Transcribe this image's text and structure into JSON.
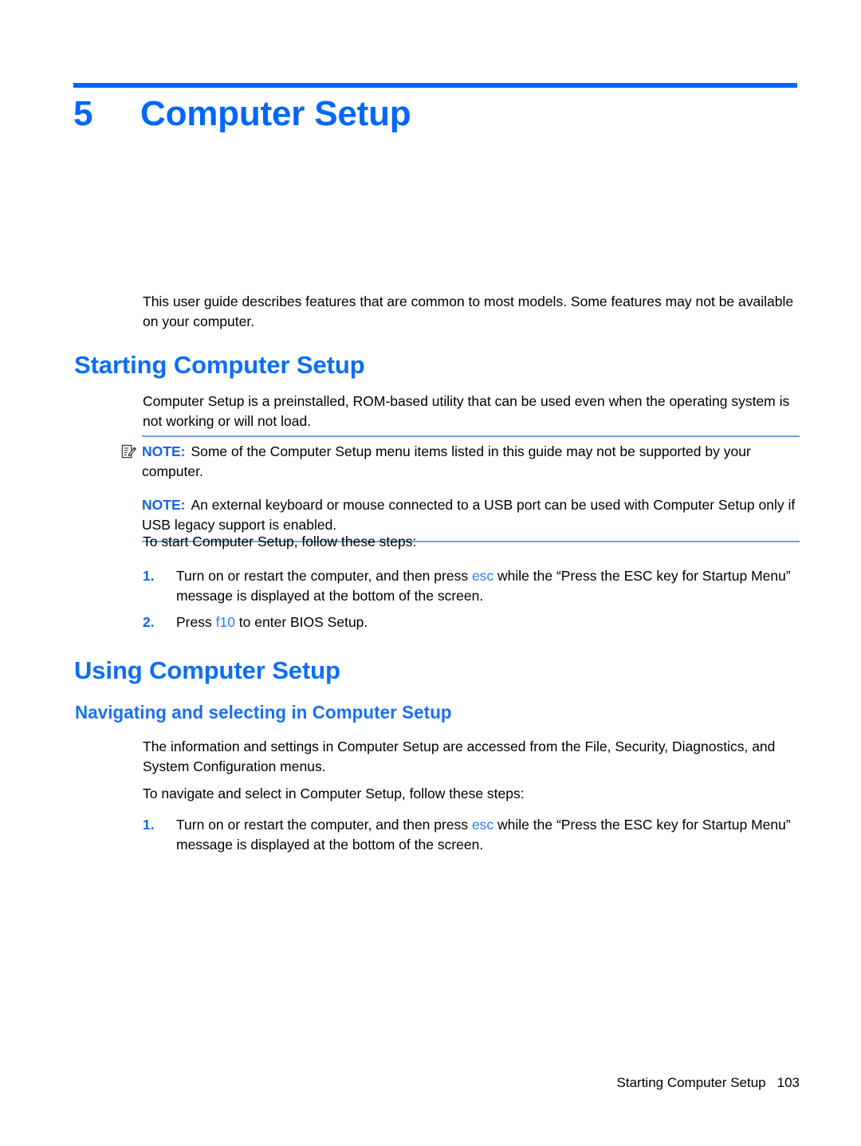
{
  "chapter": {
    "number": "5",
    "title": "Computer Setup"
  },
  "intro": {
    "paragraph": "This user guide describes features that are common to most models. Some features may not be available on your computer."
  },
  "sections": [
    {
      "heading": "Starting Computer Setup",
      "paragraph": "Computer Setup is a preinstalled, ROM-based utility that can be used even when the operating system is not working or will not load.",
      "notes": [
        {
          "icon": "note-pencil-icon",
          "label": "NOTE:",
          "text": "Some of the Computer Setup menu items listed in this guide may not be supported by your computer."
        },
        {
          "icon": null,
          "label": "NOTE:",
          "text": "An external keyboard or mouse connected to a USB port can be used with Computer Setup only if USB legacy support is enabled."
        }
      ],
      "lead_in": "To start Computer Setup, follow these steps:",
      "steps": [
        {
          "number": "1.",
          "parts": [
            {
              "type": "text",
              "value": "Turn on or restart the computer, and then press "
            },
            {
              "type": "key",
              "value": "esc"
            },
            {
              "type": "text",
              "value": " while the “Press the ESC key for Startup Menu” message is displayed at the bottom of the screen."
            }
          ]
        },
        {
          "number": "2.",
          "parts": [
            {
              "type": "text",
              "value": "Press "
            },
            {
              "type": "key",
              "value": "f10"
            },
            {
              "type": "text",
              "value": " to enter BIOS Setup."
            }
          ]
        }
      ]
    },
    {
      "heading": "Using Computer Setup",
      "subheading": "Navigating and selecting in Computer Setup",
      "paragraph": "The information and settings in Computer Setup are accessed from the File, Security, Diagnostics, and System Configuration menus.",
      "lead_in": "To navigate and select in Computer Setup, follow these steps:",
      "steps": [
        {
          "number": "1.",
          "parts": [
            {
              "type": "text",
              "value": "Turn on or restart the computer, and then press "
            },
            {
              "type": "key",
              "value": "esc"
            },
            {
              "type": "text",
              "value": " while the “Press the ESC key for Startup Menu” message is displayed at the bottom of the screen."
            }
          ]
        }
      ]
    }
  ],
  "footer": {
    "running_title": "Starting Computer Setup",
    "page_number": "103"
  },
  "colors": {
    "accent_blue": "#0066ff",
    "heading_blue": "#0a6ef5",
    "note_label_blue": "#1565e8",
    "key_blue": "#2a7ef0",
    "rule_light_blue": "#6f9fe8",
    "body_text": "#000000"
  }
}
